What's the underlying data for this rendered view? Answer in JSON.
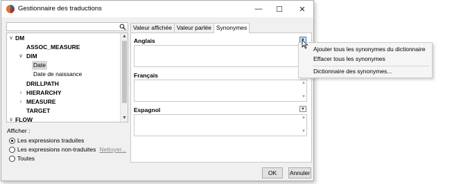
{
  "window": {
    "title": "Gestionnaire des traductions",
    "minimize": "—",
    "maximize": "☐",
    "close": "✕"
  },
  "search": {
    "value": "",
    "placeholder": ""
  },
  "tree": {
    "items": [
      {
        "label": "DM",
        "chevron": "∨"
      },
      {
        "label": "ASSOC_MEASURE",
        "chevron": ""
      },
      {
        "label": "DIM",
        "chevron": "∨"
      },
      {
        "label": "Date",
        "chevron": ""
      },
      {
        "label": "Date de  naissance",
        "chevron": ""
      },
      {
        "label": "DRILLPATH",
        "chevron": ""
      },
      {
        "label": "HIERARCHY",
        "chevron": "›"
      },
      {
        "label": "MEASURE",
        "chevron": "›"
      },
      {
        "label": "TARGET",
        "chevron": ""
      },
      {
        "label": "FLOW",
        "chevron": "∨"
      }
    ]
  },
  "filter": {
    "label": "Afficher :",
    "options": [
      {
        "label": "Les expressions traduites",
        "checked": true
      },
      {
        "label": "Les expressions non-traduites",
        "checked": false
      },
      {
        "label": "Toutes",
        "checked": false
      }
    ],
    "clean_link": "Nettoyer..."
  },
  "tabs": [
    "Valeur affichée",
    "Valeur parlée",
    "Synonymes"
  ],
  "active_tab": "Synonymes",
  "languages": [
    {
      "name": "Anglais"
    },
    {
      "name": "Français"
    },
    {
      "name": "Espagnol"
    }
  ],
  "context_menu": {
    "items": [
      "Ajouter tous les synonymes du dictionnaire",
      "Effacer tous les synonymes",
      "Dictionnaire des synonymes..."
    ]
  },
  "buttons": {
    "ok": "OK",
    "cancel": "Annuler"
  },
  "colors": {
    "accent": "#2a7ad8",
    "selection": "#d9d9d9"
  }
}
